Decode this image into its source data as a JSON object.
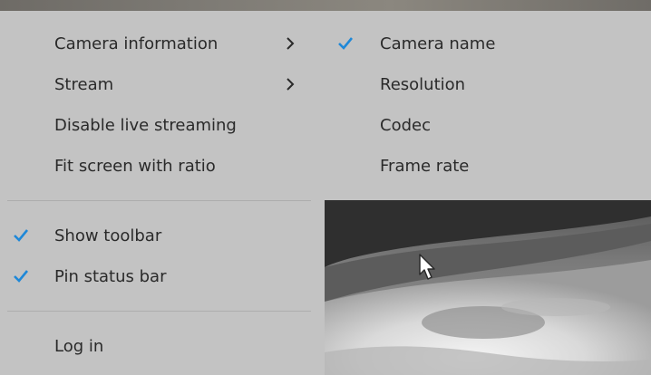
{
  "main_menu": {
    "items": [
      {
        "label": "Camera information",
        "has_submenu": true
      },
      {
        "label": "Stream",
        "has_submenu": true
      },
      {
        "label": "Disable live streaming"
      },
      {
        "label": "Fit screen with ratio"
      },
      {
        "label": "Show toolbar",
        "checked": true
      },
      {
        "label": "Pin status bar",
        "checked": true
      },
      {
        "label": "Log in"
      }
    ]
  },
  "camera_info_submenu": {
    "items": [
      {
        "label": "Camera name",
        "checked": true
      },
      {
        "label": "Resolution",
        "checked": false
      },
      {
        "label": "Codec",
        "checked": false
      },
      {
        "label": "Frame rate",
        "checked": false
      }
    ]
  },
  "colors": {
    "menu_background": "#c3c3c3",
    "text": "#2a2a2a",
    "check_accent": "#1e88d8",
    "separator": "#adadad"
  },
  "icons": {
    "check": "check-icon",
    "submenu_arrow": "chevron-right-icon",
    "cursor": "mouse-pointer-icon"
  }
}
